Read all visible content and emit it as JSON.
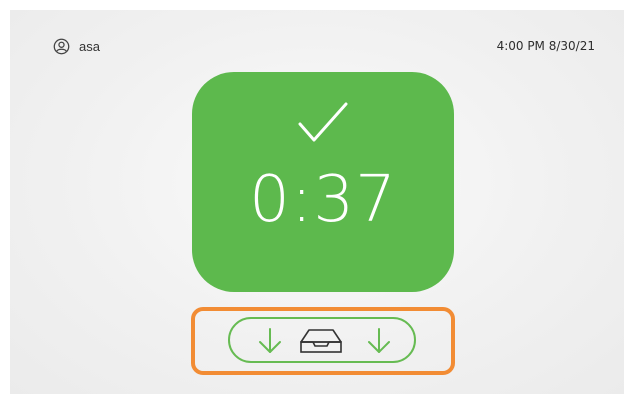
{
  "header": {
    "username": "asa",
    "datetime": "4:00 PM 8/30/21"
  },
  "status": {
    "timer": "0:37",
    "state_icon": "check-icon",
    "card_color": "#5db94d"
  },
  "controls": {
    "left_icon": "arrow-down-icon",
    "center_icon": "tray-icon",
    "right_icon": "arrow-down-icon",
    "accent": "#66bb52",
    "highlight_color": "#f28c34"
  }
}
